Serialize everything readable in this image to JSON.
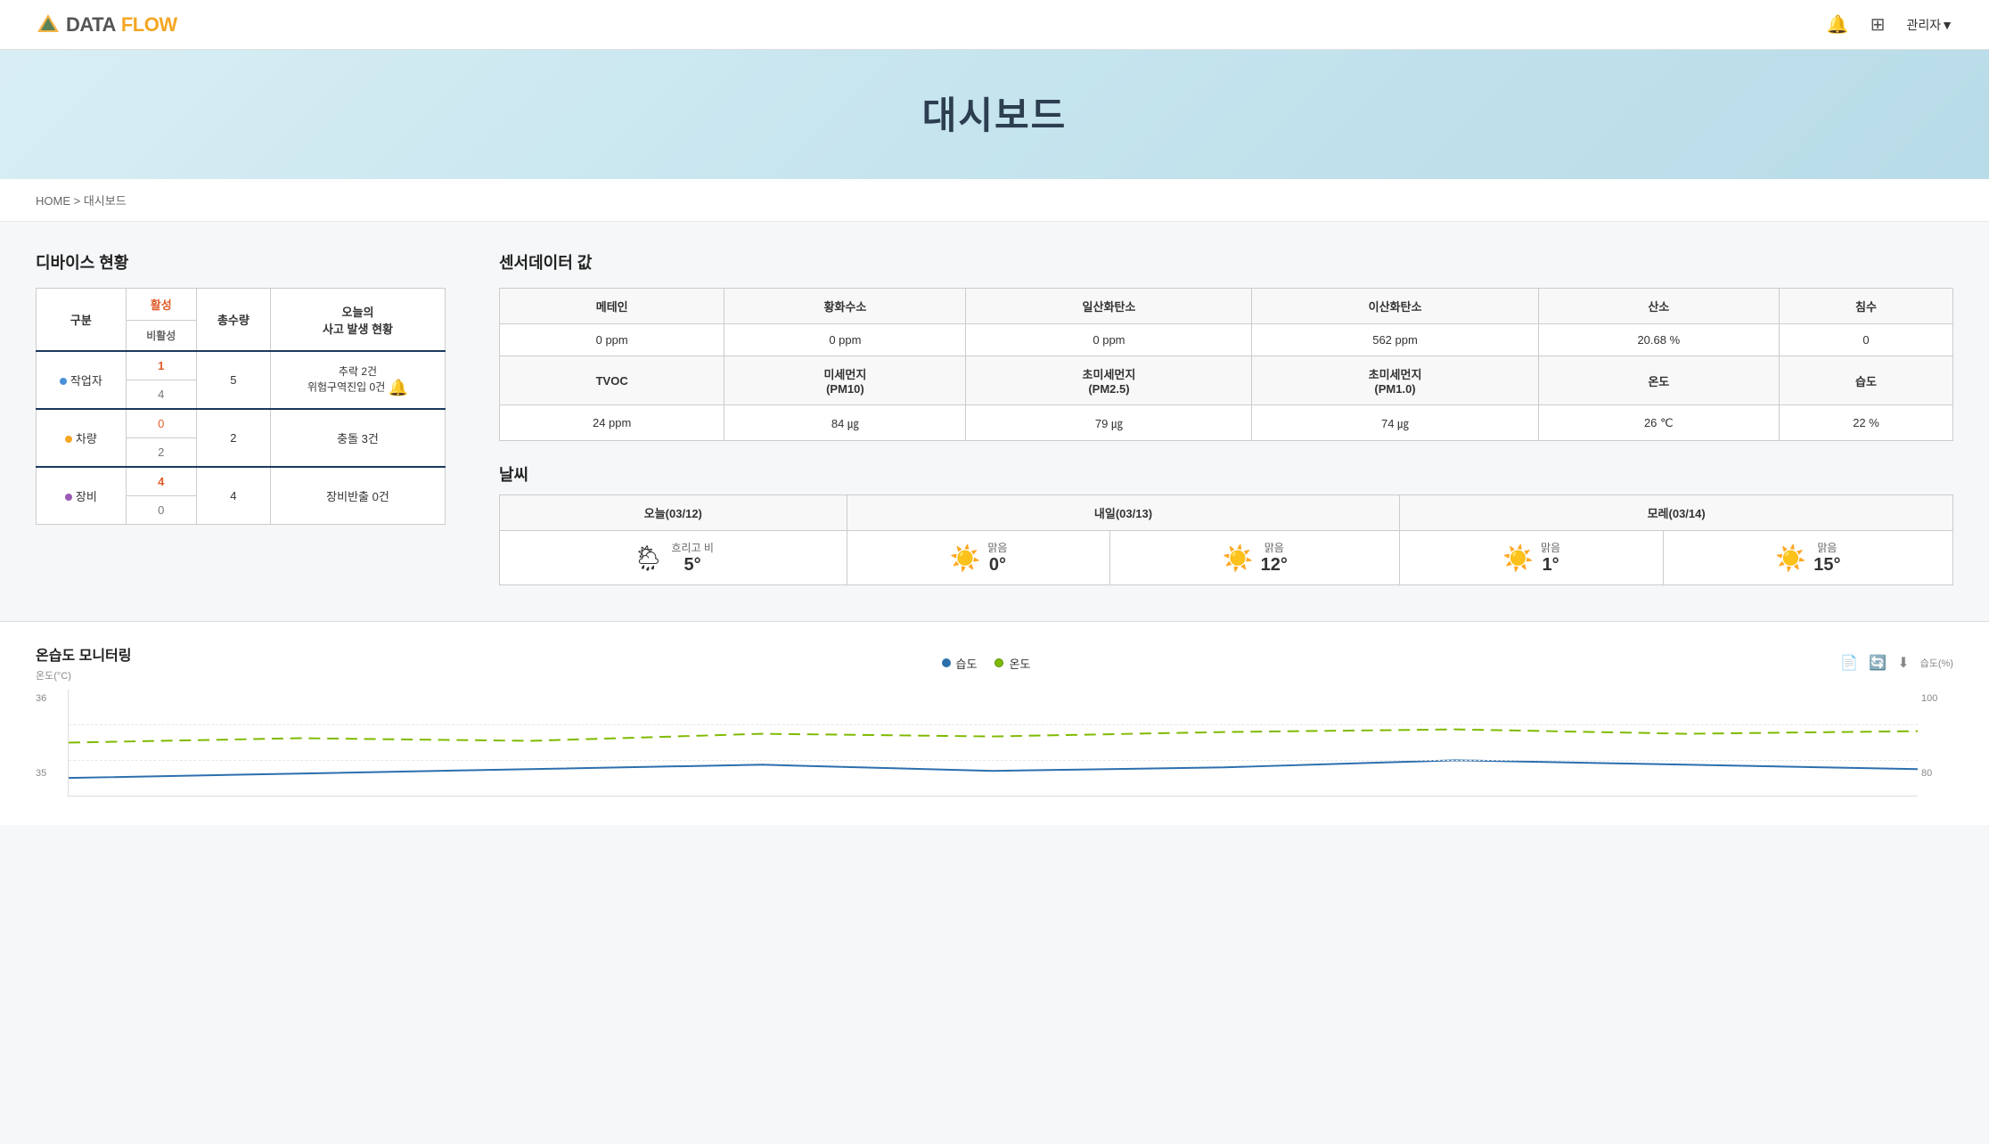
{
  "header": {
    "logo_text_data": "DATA",
    "logo_text_flow": "FLOW",
    "bell_icon": "🔔",
    "grid_icon": "⊞",
    "admin_label": "관리자▼"
  },
  "hero": {
    "title": "대시보드"
  },
  "breadcrumb": {
    "text": "HOME > 대시보드"
  },
  "device_section": {
    "title": "디바이스 현황",
    "table": {
      "headers": [
        "구분",
        "활성",
        "총수량",
        "오늘의 사고 발생 현황"
      ],
      "subheader_active": "활성",
      "subheader_inactive": "비활성",
      "rows": [
        {
          "category": "작업자",
          "dot_color": "blue",
          "active": "1",
          "inactive": "4",
          "total": "5",
          "accident": "추락 2건\n위험구역진입 0건"
        },
        {
          "category": "차량",
          "dot_color": "orange",
          "active": "0",
          "inactive": "2",
          "total": "2",
          "accident": "충돌 3건"
        },
        {
          "category": "장비",
          "dot_color": "purple",
          "active": "4",
          "inactive": "0",
          "total": "4",
          "accident": "장비반출 0건"
        }
      ]
    }
  },
  "sensor_section": {
    "title": "센서데이터 값",
    "headers": [
      "메테인",
      "황화수소",
      "일산화탄소",
      "이산화탄소",
      "산소",
      "침수"
    ],
    "row1": [
      "0 ppm",
      "0 ppm",
      "0 ppm",
      "562 ppm",
      "20.68 %",
      "0"
    ],
    "sub_headers": [
      "TVOC",
      "미세먼지(PM10)",
      "초미세먼지(PM2.5)",
      "초미세먼지(PM1.0)",
      "온도",
      "습도"
    ],
    "row2": [
      "24 ppm",
      "84 ㎍",
      "79 ㎍",
      "74 ㎍",
      "26 ℃",
      "22 %"
    ]
  },
  "weather_section": {
    "title": "날씨",
    "days": [
      {
        "label": "오늘(03/12)",
        "icon": "🌦",
        "desc": "흐리고 비",
        "temp": "5°"
      },
      {
        "label": "내일(03/13)",
        "icon": "☀️",
        "desc": "맑음",
        "temp": "0°"
      },
      {
        "label": "",
        "icon": "☀️",
        "desc": "맑음",
        "temp": "12°"
      },
      {
        "label": "모레(03/14)",
        "icon": "☀️",
        "desc": "맑음",
        "temp": "1°"
      },
      {
        "label": "",
        "icon": "☀️",
        "desc": "맑음",
        "temp": "15°"
      }
    ]
  },
  "monitoring_section": {
    "title": "온습도 모니터링",
    "legend_humidity": "습도",
    "legend_temp": "온도",
    "y_axis_left_label": "온도(°C)",
    "y_axis_right_label": "습도(%)",
    "y_left_values": [
      "36",
      "35"
    ],
    "y_right_values": [
      "100",
      "80"
    ]
  }
}
